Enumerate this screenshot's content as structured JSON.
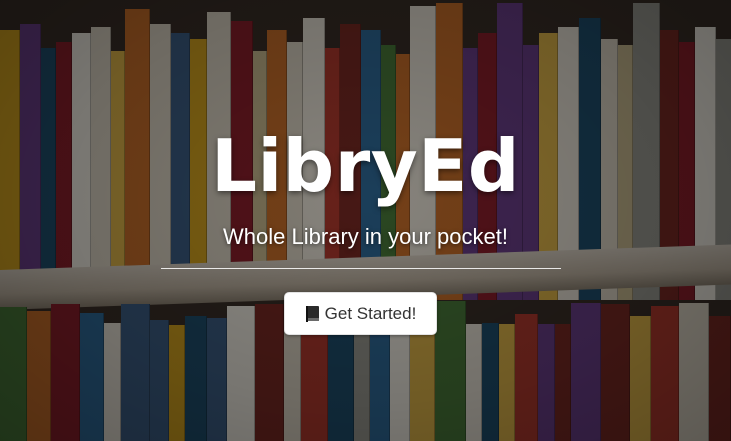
{
  "hero": {
    "title": "LibryEd",
    "tagline": "Whole Library in your pocket!",
    "cta": {
      "label": "Get Started!",
      "icon": "book-icon"
    }
  },
  "colors": {
    "title_text": "#ffffff",
    "button_bg": "#ffffff",
    "button_text": "#333333"
  }
}
